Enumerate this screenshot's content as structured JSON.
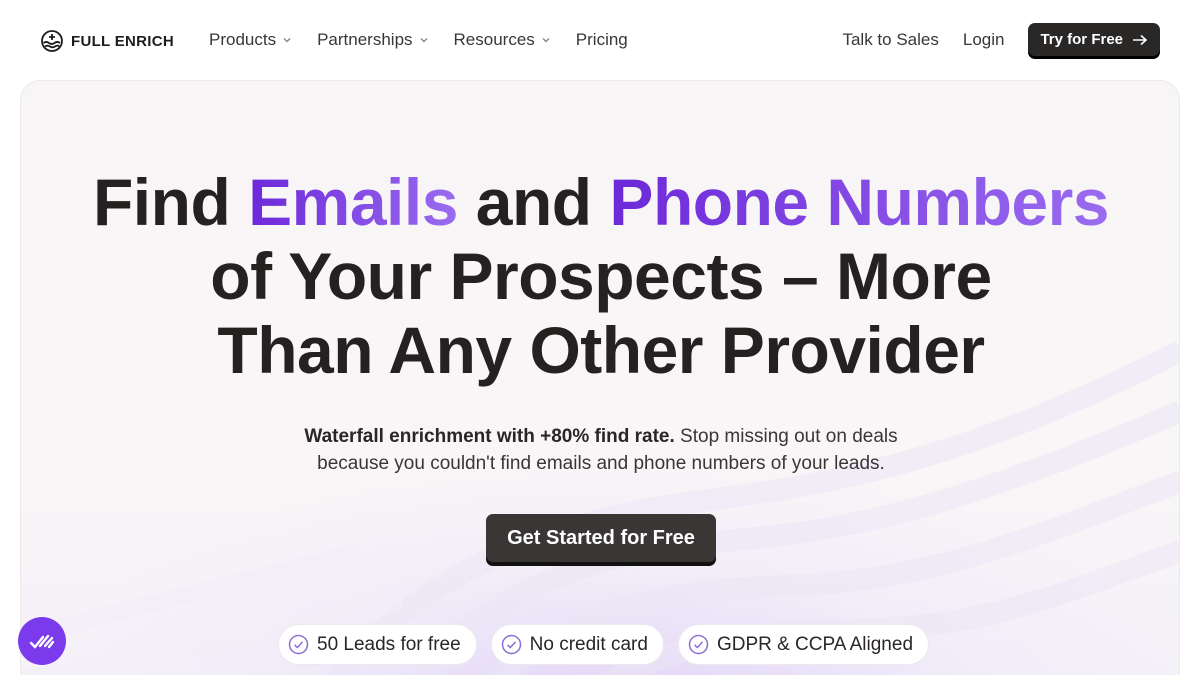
{
  "brand": {
    "name": "FULL ENRICH",
    "logo_icon": "wave-globe-logo-icon"
  },
  "nav": {
    "items": [
      {
        "label": "Products",
        "has_dropdown": true
      },
      {
        "label": "Partnerships",
        "has_dropdown": true
      },
      {
        "label": "Resources",
        "has_dropdown": true
      },
      {
        "label": "Pricing",
        "has_dropdown": false
      }
    ],
    "talk_to_sales": "Talk to Sales",
    "login": "Login",
    "try_free": "Try for Free"
  },
  "hero": {
    "headline": {
      "part1": "Find ",
      "emails": "Emails",
      "part2": " and ",
      "phone_numbers": "Phone Numbers",
      "line2": "of Your Prospects – More",
      "line3": "Than Any Other Provider"
    },
    "subtitle_bold": "Waterfall enrichment with +80% find rate.",
    "subtitle_rest": " Stop missing out on deals",
    "subtitle_line2": "because you couldn't find emails and phone numbers of your leads.",
    "cta_label": "Get Started for Free",
    "badges": [
      {
        "label": "50 Leads for free",
        "icon": "check-circle-icon"
      },
      {
        "label": "No credit card",
        "icon": "check-circle-icon"
      },
      {
        "label": "GDPR & CCPA Aligned",
        "icon": "check-circle-icon"
      }
    ]
  },
  "colors": {
    "accent_purple": "#7c3aed",
    "dark_button": "#2a2727",
    "text_dark": "#252121"
  }
}
